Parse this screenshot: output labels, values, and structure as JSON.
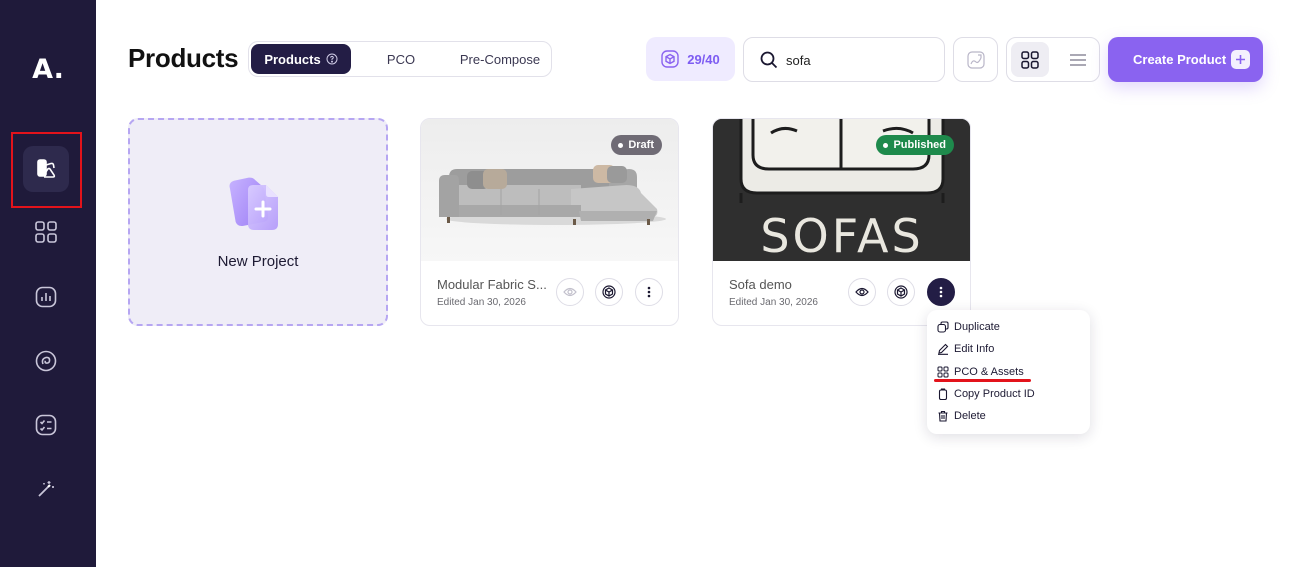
{
  "sidebar": {
    "logo": "A.",
    "items": [
      {
        "name": "products-nav",
        "icon": "products-icon",
        "active": true
      },
      {
        "name": "apps-nav",
        "icon": "grid-icon",
        "active": false
      },
      {
        "name": "analytics-nav",
        "icon": "chart-icon",
        "active": false
      },
      {
        "name": "integrations-nav",
        "icon": "swirl-icon",
        "active": false
      },
      {
        "name": "tasks-nav",
        "icon": "checklist-icon",
        "active": false
      },
      {
        "name": "magic-nav",
        "icon": "magic-wand-icon",
        "active": false
      }
    ]
  },
  "header": {
    "title": "Products",
    "tabs": [
      {
        "label": "Products",
        "active": true
      },
      {
        "label": "PCO",
        "active": false
      },
      {
        "label": "Pre-Compose",
        "active": false
      }
    ],
    "quota": "29/40",
    "search_value": "sofa",
    "create_label": "Create Product"
  },
  "new_project": {
    "label": "New Project"
  },
  "products": [
    {
      "name": "Modular Fabric S...",
      "edited": "Edited Jan 30, 2026",
      "status": "Draft"
    },
    {
      "name": "Sofa demo",
      "edited": "Edited Jan 30, 2026",
      "status": "Published",
      "thumb_text": "SOFAS"
    }
  ],
  "menu": {
    "items": [
      {
        "label": "Duplicate",
        "icon": "duplicate-icon"
      },
      {
        "label": "Edit Info",
        "icon": "pencil-icon"
      },
      {
        "label": "PCO & Assets",
        "icon": "grid-icon"
      },
      {
        "label": "Copy Product ID",
        "icon": "copy-icon"
      },
      {
        "label": "Delete",
        "icon": "trash-icon"
      }
    ]
  },
  "colors": {
    "sidebar": "#1f1a3a",
    "accent": "#8a63f0",
    "published": "#1e8a4c",
    "draft": "#6f6b75",
    "annotation": "#e3131b"
  }
}
